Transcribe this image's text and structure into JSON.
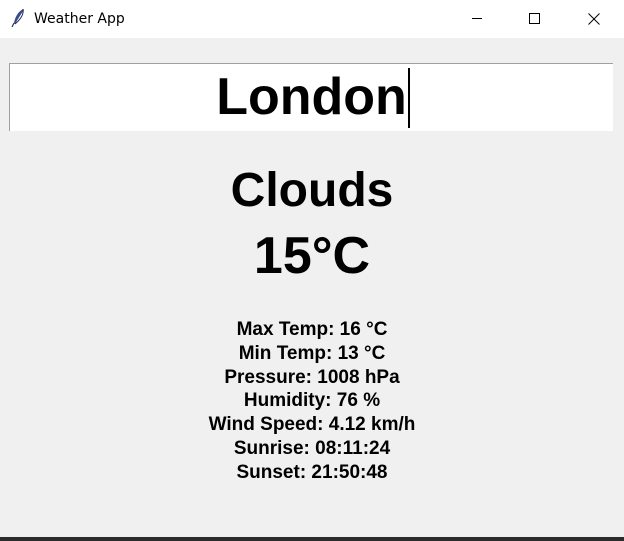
{
  "window": {
    "title": "Weather App"
  },
  "search": {
    "city_value": "London"
  },
  "weather": {
    "condition": "Clouds",
    "temperature": "15°C"
  },
  "details": {
    "max_temp": "Max Temp: 16 °C",
    "min_temp": "Min Temp: 13 °C",
    "pressure": "Pressure: 1008 hPa",
    "humidity": "Humidity: 76 %",
    "wind_speed": "Wind Speed: 4.12 km/h",
    "sunrise": "Sunrise: 08:11:24",
    "sunset": "Sunset: 21:50:48"
  },
  "icons": {
    "app": "feather-icon",
    "minimize": "minimize-icon",
    "maximize": "maximize-icon",
    "close": "close-icon"
  },
  "colors": {
    "background": "#f0f0f0",
    "titlebar": "#ffffff",
    "text": "#000000"
  }
}
